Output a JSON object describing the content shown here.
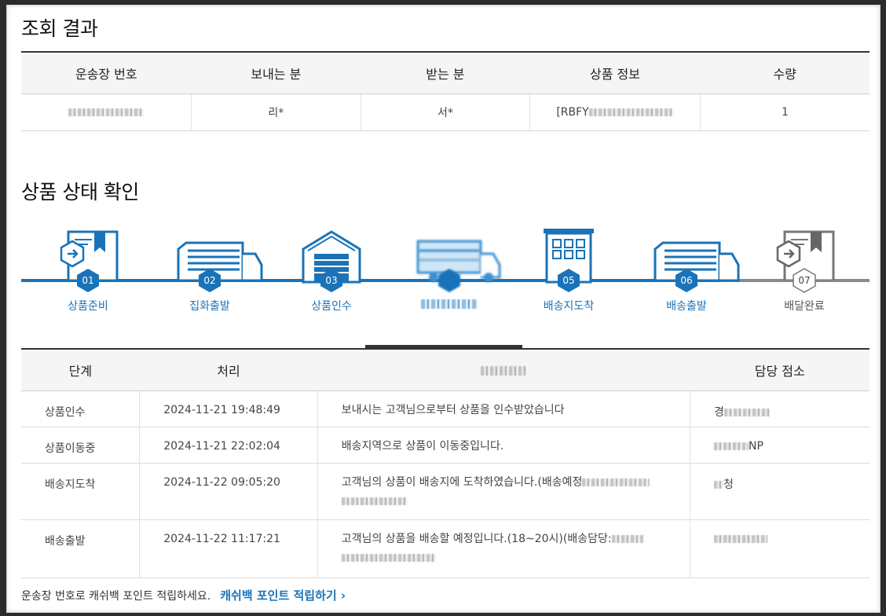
{
  "result": {
    "title": "조회 결과",
    "headers": [
      "운송장 번호",
      "보내는 분",
      "받는 분",
      "상품 정보",
      "수량"
    ],
    "row": {
      "sender": "리*",
      "receiver": "서*",
      "product_prefix": "[RBFY",
      "quantity": "1"
    }
  },
  "status": {
    "title": "상품 상태 확인",
    "steps": [
      {
        "num": "01",
        "label": "상품준비",
        "icon": "box-icon"
      },
      {
        "num": "02",
        "label": "집화출발",
        "icon": "truck-icon"
      },
      {
        "num": "03",
        "label": "상품인수",
        "icon": "warehouse-icon"
      },
      {
        "num": "",
        "label": "",
        "icon": "truck-icon"
      },
      {
        "num": "05",
        "label": "배송지도착",
        "icon": "building-icon"
      },
      {
        "num": "06",
        "label": "배송출발",
        "icon": "truck-icon"
      },
      {
        "num": "07",
        "label": "배달완료",
        "icon": "box-icon"
      }
    ]
  },
  "history": {
    "headers": [
      "단계",
      "처리",
      "",
      "담당 점소"
    ],
    "rows": [
      {
        "stage": "상품인수",
        "time": "2024-11-21 19:48:49",
        "desc": "보내시는 고객님으로부터 상품을 인수받았습니다",
        "office": "경"
      },
      {
        "stage": "상품이동중",
        "time": "2024-11-21 22:02:04",
        "desc": "배송지역으로 상품이 이동중입니다.",
        "office": "NP"
      },
      {
        "stage": "배송지도착",
        "time": "2024-11-22 09:05:20",
        "desc": "고객님의 상품이 배송지에 도착하였습니다.(배송예정",
        "office": "청"
      },
      {
        "stage": "배송출발",
        "time": "2024-11-22 11:17:21",
        "desc": "고객님의 상품을 배송할 예정입니다.(18~20시)(배송담당:",
        "office": ""
      }
    ]
  },
  "footer": {
    "text": "운송장 번호로 캐쉬백 포인트 적립하세요.",
    "link": "캐쉬백 포인트 적립하기 ›"
  },
  "colors": {
    "accent": "#1a73b8",
    "inactive": "#8a8a8a"
  }
}
